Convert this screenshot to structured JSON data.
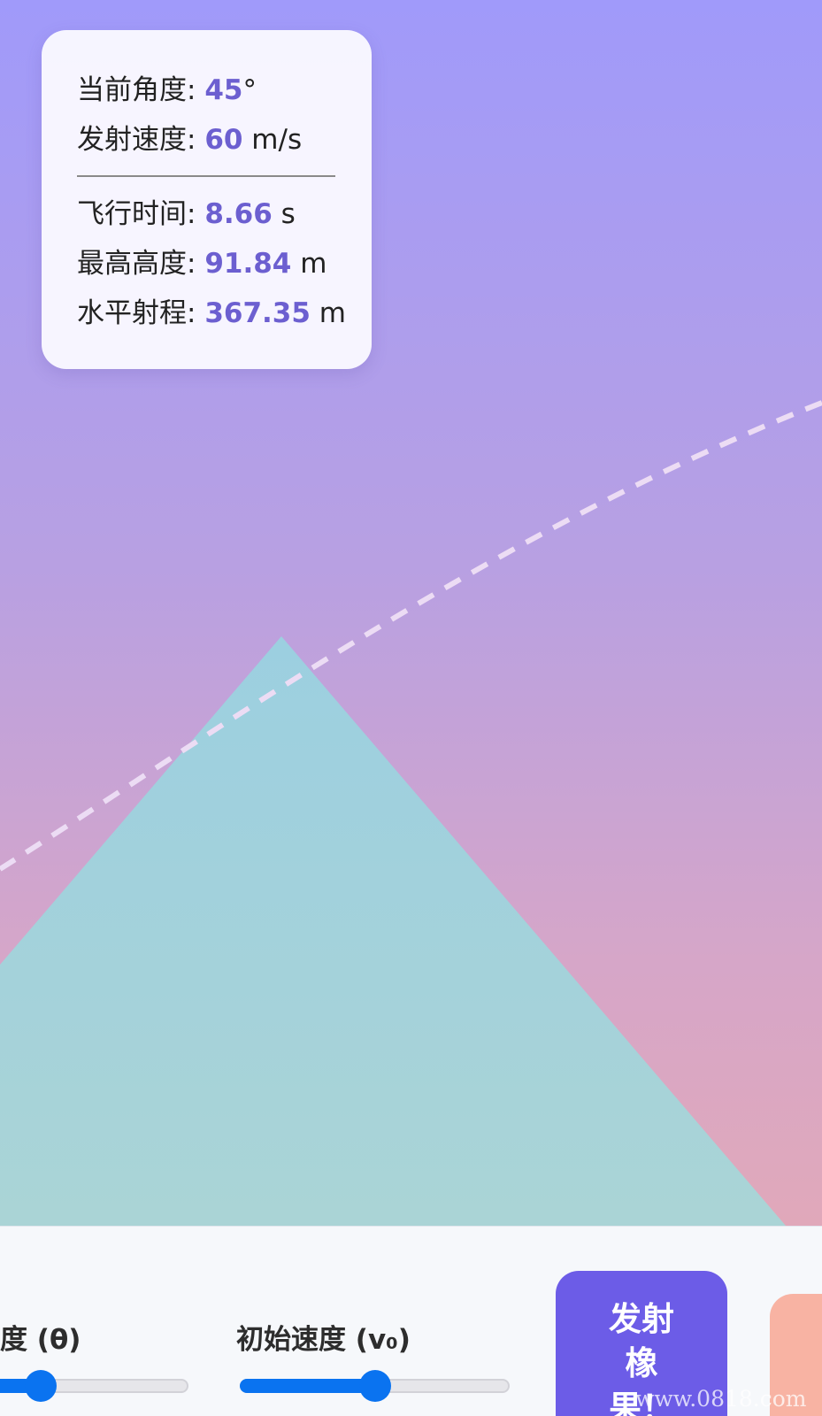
{
  "info": {
    "angle_label": "当前角度: ",
    "angle_value": "45",
    "angle_unit": "°",
    "speed_label": "发射速度: ",
    "speed_value": "60",
    "speed_unit": " m/s",
    "time_label": "飞行时间: ",
    "time_value": "8.66",
    "time_unit": " s",
    "height_label": "最高高度: ",
    "height_value": "91.84",
    "height_unit": " m",
    "range_label": "水平射程: ",
    "range_value": "367.35",
    "range_unit": " m"
  },
  "controls": {
    "angle_label": "度 (θ)",
    "angle_slider_level": 0.25,
    "speed_label": "初始速度 (v₀)",
    "speed_slider_level": 0.5,
    "launch_button_line1": "发射",
    "launch_button_line2": "橡",
    "launch_button_line3": "果！"
  },
  "watermark": "www.0818.com",
  "colors": {
    "accent": "#6c5ce7",
    "value_text": "#6c5fd0",
    "slider_active": "#0a73f0",
    "mountain": "#a0d2dc",
    "trajectory": "#ecdcf4",
    "reset_button": "#f8b3a3"
  }
}
